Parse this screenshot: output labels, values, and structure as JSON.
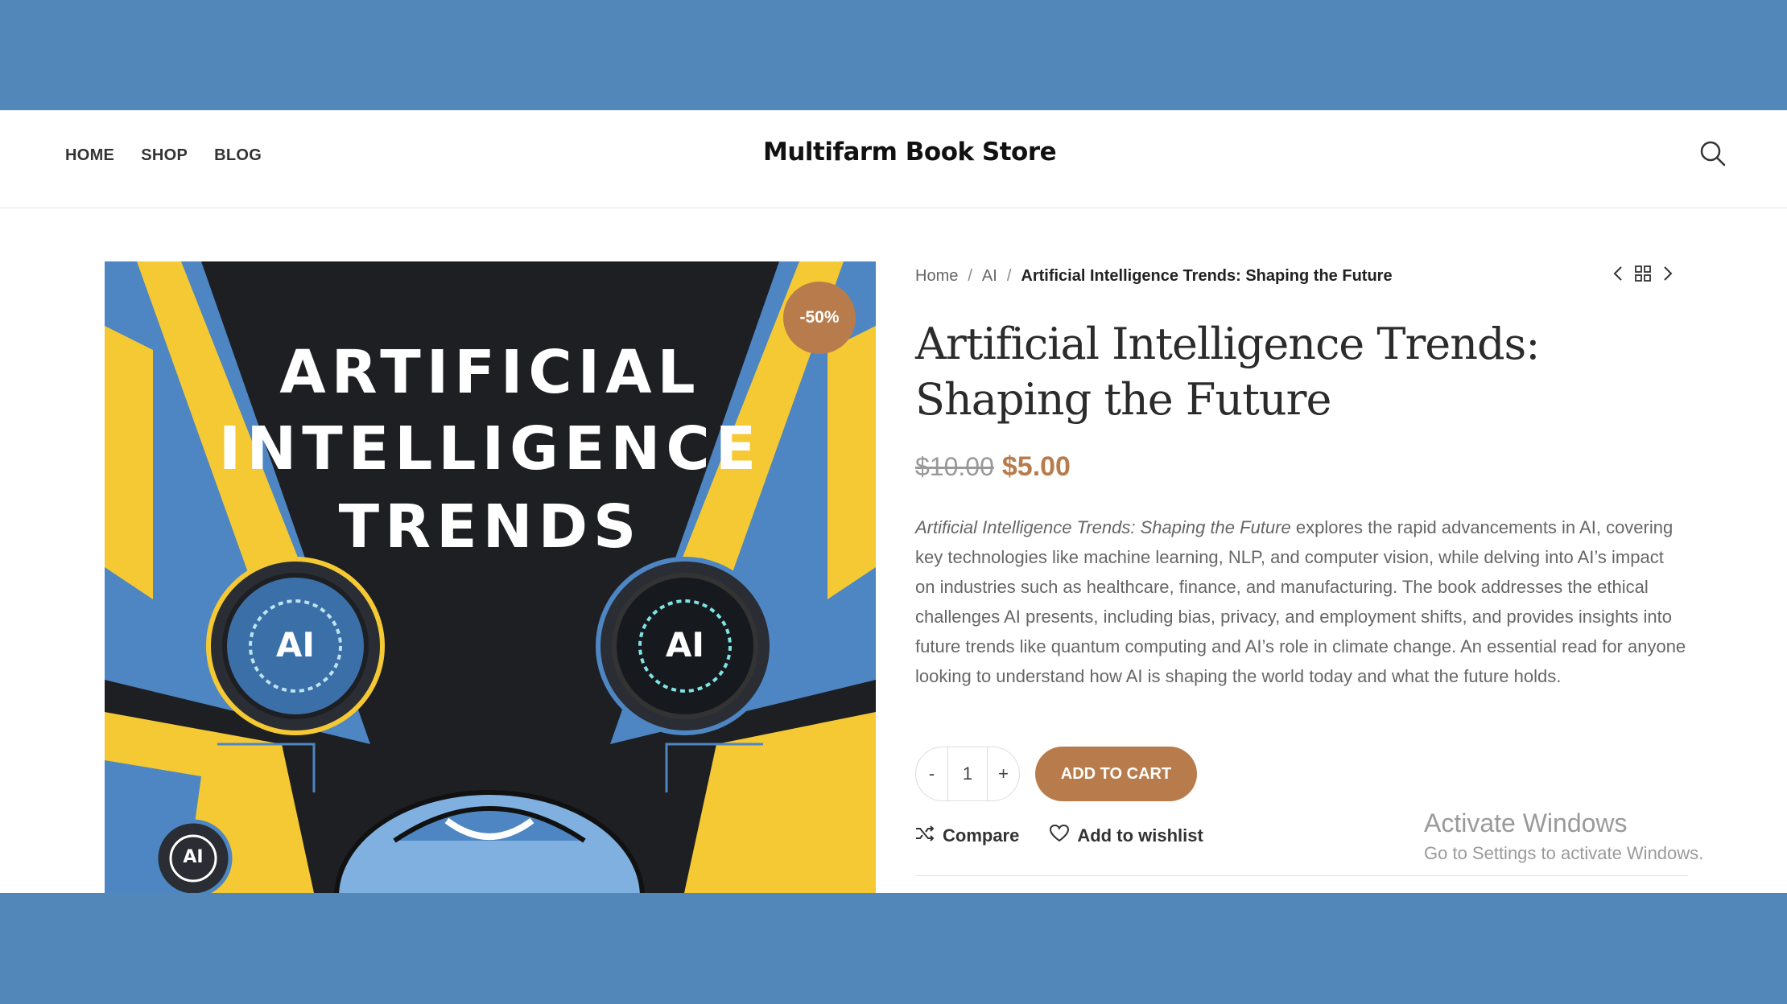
{
  "header": {
    "nav": [
      "HOME",
      "SHOP",
      "BLOG"
    ],
    "logo": "Multifarm Book Store"
  },
  "product": {
    "cover": {
      "lines": [
        "ARTIFICIAL",
        "INTELLIGENCE",
        "TRENDS"
      ],
      "ai_labels": [
        "AI",
        "AI",
        "AI"
      ]
    },
    "badge": "-50%",
    "breadcrumb": [
      "Home",
      "AI",
      "Artificial Intelligence Trends: Shaping the Future"
    ],
    "title_line1": "Artificial Intelligence Trends:",
    "title_line2": "Shaping the Future",
    "old_price": "$10.00",
    "new_price": "$5.00",
    "description_title": "Artificial Intelligence Trends: Shaping the Future",
    "description_body": " explores the rapid advancements in AI, covering key technologies like machine learning, NLP, and computer vision, while delving into AI’s impact on industries such as healthcare, finance, and manufacturing. The book addresses the ethical challenges AI presents, including bias, privacy, and employment shifts, and provides insights into future trends like quantum computing and AI’s role in climate change. An essential read for anyone looking to understand how AI is shaping the world today and what the future holds.",
    "quantity": "1",
    "minus_label": "-",
    "plus_label": "+",
    "add_to_cart": "ADD TO CART",
    "compare": "Compare",
    "wishlist": "Add to wishlist"
  },
  "watermark": {
    "line1": "Activate Windows",
    "line2": "Go to Settings to activate Windows."
  },
  "colors": {
    "frame": "#5287b9",
    "accent": "#b87c4c",
    "cover_yellow": "#f5c933",
    "cover_blue": "#4d86c2"
  },
  "icons": [
    "search-icon",
    "chevron-left-icon",
    "grid-icon",
    "chevron-right-icon",
    "shuffle-icon",
    "heart-icon"
  ]
}
